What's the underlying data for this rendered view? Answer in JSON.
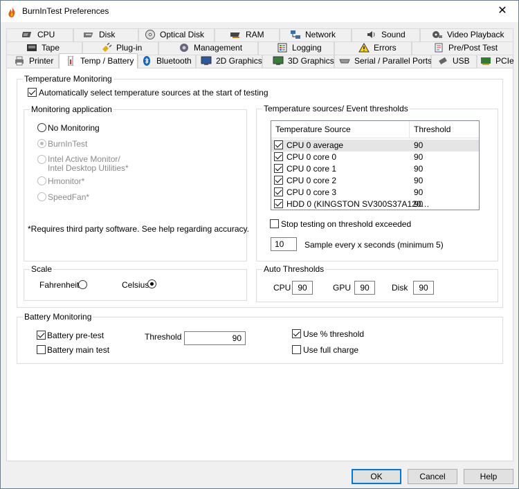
{
  "window": {
    "title": "BurnInTest Preferences",
    "close_glyph": "✕"
  },
  "tabs": {
    "row1": [
      {
        "label": "CPU",
        "icon": "cpu-chip-icon"
      },
      {
        "label": "Disk",
        "icon": "hard-disk-icon"
      },
      {
        "label": "Optical Disk",
        "icon": "optical-disc-icon"
      },
      {
        "label": "RAM",
        "icon": "ram-module-icon"
      },
      {
        "label": "Network",
        "icon": "network-icon"
      },
      {
        "label": "Sound",
        "icon": "speaker-icon"
      },
      {
        "label": "Video Playback",
        "icon": "film-reel-icon"
      }
    ],
    "row2": [
      {
        "label": "Tape",
        "icon": "tape-drive-icon"
      },
      {
        "label": "Plug-in",
        "icon": "plug-icon"
      },
      {
        "label": "Management",
        "icon": "management-icon"
      },
      {
        "label": "Logging",
        "icon": "log-list-icon"
      },
      {
        "label": "Errors",
        "icon": "warning-icon"
      },
      {
        "label": "Pre/Post Test",
        "icon": "pre-post-test-icon"
      }
    ],
    "row3": [
      {
        "label": "Printer",
        "icon": "printer-icon"
      },
      {
        "label": "Temp / Battery",
        "icon": "thermometer-icon"
      },
      {
        "label": "Bluetooth",
        "icon": "bluetooth-icon"
      },
      {
        "label": "2D Graphics",
        "icon": "monitor-2d-icon"
      },
      {
        "label": "3D Graphics",
        "icon": "monitor-3d-icon"
      },
      {
        "label": "Serial / Parallel Ports",
        "icon": "serial-port-icon"
      },
      {
        "label": "USB",
        "icon": "usb-icon"
      },
      {
        "label": "PCIe",
        "icon": "pcie-card-icon"
      }
    ],
    "active": "Temp / Battery"
  },
  "temperature_monitoring": {
    "legend": "Temperature Monitoring",
    "auto_select_label": "Automatically select temperature sources at the start of testing",
    "auto_select_checked": true,
    "monitoring_application": {
      "legend": "Monitoring application",
      "options": [
        {
          "label": "No Monitoring",
          "selected": true,
          "enabled": true
        },
        {
          "label": "BurnInTest",
          "selected": true,
          "enabled": false
        },
        {
          "label": "Intel Active Monitor/",
          "label2": "Intel Desktop Utilities*",
          "selected": false,
          "enabled": false
        },
        {
          "label": "Hmonitor*",
          "selected": false,
          "enabled": false
        },
        {
          "label": "SpeedFan*",
          "selected": false,
          "enabled": false
        }
      ],
      "note": "*Requires third party software. See help regarding accuracy."
    },
    "scale": {
      "legend": "Scale",
      "fahrenheit_label": "Fahrenheit",
      "celsius_label": "Celsius",
      "selected": "Celsius"
    },
    "sources": {
      "legend": "Temperature sources/ Event thresholds",
      "columns": [
        "Temperature Source",
        "Threshold"
      ],
      "rows": [
        {
          "source": "CPU 0 average",
          "threshold": "90",
          "checked": true
        },
        {
          "source": "CPU 0 core 0",
          "threshold": "90",
          "checked": true
        },
        {
          "source": "CPU 0 core 1",
          "threshold": "90",
          "checked": true
        },
        {
          "source": "CPU 0 core 2",
          "threshold": "90",
          "checked": true
        },
        {
          "source": "CPU 0 core 3",
          "threshold": "90",
          "checked": true
        },
        {
          "source": "HDD 0 (KINGSTON SV300S37A120…",
          "threshold": "90",
          "checked": true
        }
      ],
      "stop_on_threshold_label": "Stop testing on threshold exceeded",
      "stop_on_threshold_checked": false,
      "sample_value": "10",
      "sample_label": "Sample every x seconds (minimum 5)"
    },
    "auto_thresholds": {
      "legend": "Auto Thresholds",
      "cpu_label": "CPU",
      "cpu_value": "90",
      "gpu_label": "GPU",
      "gpu_value": "90",
      "disk_label": "Disk",
      "disk_value": "90"
    }
  },
  "battery_monitoring": {
    "legend": "Battery Monitoring",
    "pretest_label": "Battery pre-test",
    "pretest_checked": true,
    "maintest_label": "Battery main test",
    "maintest_checked": false,
    "threshold_label": "Threshold",
    "threshold_value": "90",
    "use_percent_label": "Use % threshold",
    "use_percent_checked": true,
    "full_charge_label": "Use full charge",
    "full_charge_checked": false
  },
  "buttons": {
    "ok": "OK",
    "cancel": "Cancel",
    "help": "Help"
  },
  "colors": {
    "accent": "#0078d7",
    "selected_row": "#e5e5e5"
  }
}
